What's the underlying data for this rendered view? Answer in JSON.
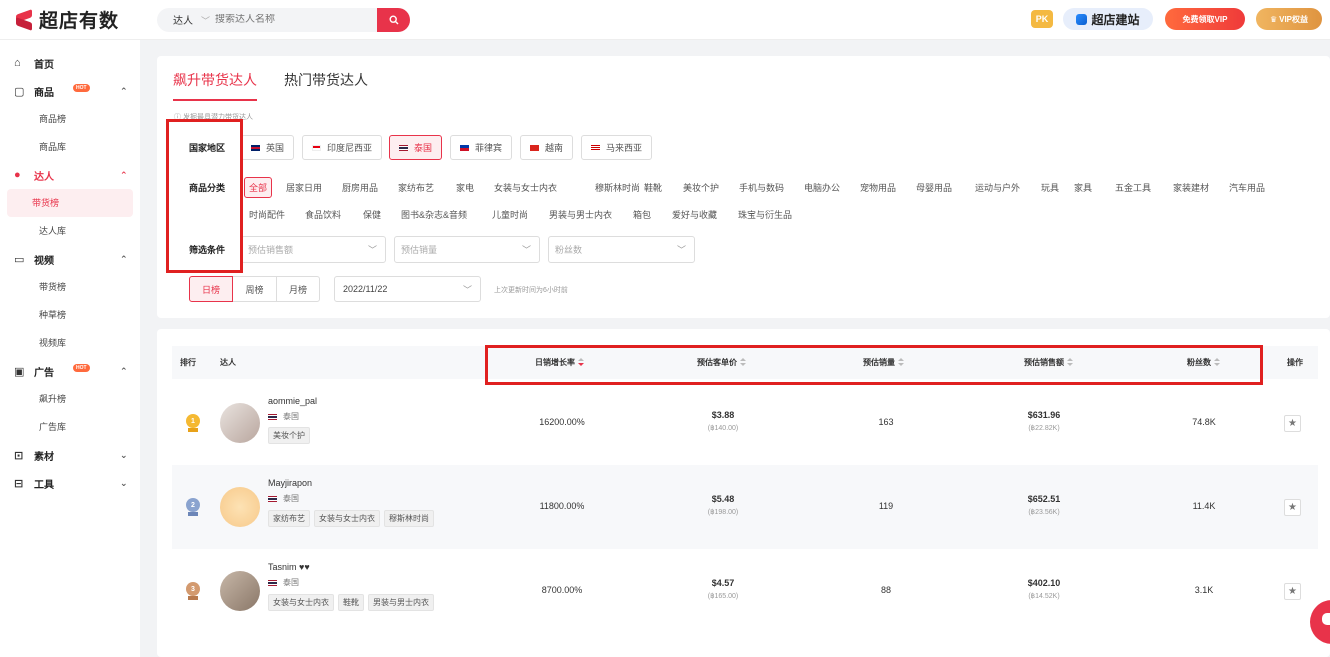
{
  "app": {
    "name": "超店有数"
  },
  "search": {
    "type": "达人",
    "placeholder": "搜索达人名称"
  },
  "topbar": {
    "pk": "PK",
    "build": "超店建站",
    "free_vip": "免费领取VIP",
    "vip": "VIP权益"
  },
  "sidebar": {
    "home": "首页",
    "products": {
      "label": "商品",
      "badge": "HOT",
      "items": [
        "商品榜",
        "商品库"
      ]
    },
    "creators": {
      "label": "达人",
      "items": [
        "带货榜",
        "达人库"
      ]
    },
    "video": {
      "label": "视频",
      "items": [
        "带货榜",
        "种草榜",
        "视频库"
      ]
    },
    "ads": {
      "label": "广告",
      "badge": "HOT",
      "items": [
        "飙升榜",
        "广告库"
      ]
    },
    "material": {
      "label": "素材"
    },
    "tools": {
      "label": "工具"
    }
  },
  "tabs": [
    "飙升带货达人",
    "热门带货达人"
  ],
  "tip": "发掘最具潜力带货达人",
  "filters": {
    "country_label": "国家地区",
    "category_label": "商品分类",
    "condition_label": "筛选条件",
    "countries": [
      "英国",
      "印度尼西亚",
      "泰国",
      "菲律宾",
      "越南",
      "马来西亚"
    ],
    "selected_country": "泰国",
    "categories_row1": [
      "全部",
      "居家日用",
      "厨房用品",
      "家纺布艺",
      "家电",
      "女装与女士内衣",
      "穆斯林时尚",
      "鞋靴",
      "美妆个护",
      "手机与数码",
      "电脑办公",
      "宠物用品",
      "母婴用品",
      "运动与户外",
      "玩具",
      "家具",
      "五金工具",
      "家装建材",
      "汽车用品"
    ],
    "categories_row2": [
      "时尚配件",
      "食品饮料",
      "保健",
      "图书&杂志&音频",
      "儿童时尚",
      "男装与男士内衣",
      "箱包",
      "爱好与收藏",
      "珠宝与衍生品"
    ],
    "conditions": [
      "预估销售额",
      "预估销量",
      "粉丝数"
    ],
    "periods": [
      "日榜",
      "周榜",
      "月榜"
    ],
    "date": "2022/11/22",
    "update_note": "上次更新时间为6小时前"
  },
  "table": {
    "headers": {
      "rank": "排行",
      "creator": "达人",
      "growth": "日销增长率",
      "unit_price": "预估客单价",
      "sales": "预估销量",
      "revenue": "预估销售额",
      "fans": "粉丝数",
      "action": "操作"
    },
    "rows": [
      {
        "rank": "1",
        "name": "aommie_pal",
        "country": "泰国",
        "tags": [
          "美妆个护"
        ],
        "growth": "16200.00%",
        "price": "$3.88",
        "price_local": "(฿140.00)",
        "sales": "163",
        "revenue": "$631.96",
        "revenue_local": "(฿22.82K)",
        "fans": "74.8K"
      },
      {
        "rank": "2",
        "name": "Mayjirapon",
        "country": "泰国",
        "tags": [
          "家纺布艺",
          "女装与女士内衣",
          "穆斯林时尚"
        ],
        "growth": "11800.00%",
        "price": "$5.48",
        "price_local": "(฿198.00)",
        "sales": "119",
        "revenue": "$652.51",
        "revenue_local": "(฿23.56K)",
        "fans": "11.4K"
      },
      {
        "rank": "3",
        "name": "Tasnim ♥♥",
        "country": "泰国",
        "tags": [
          "女装与女士内衣",
          "鞋靴",
          "男装与男士内衣"
        ],
        "growth": "8700.00%",
        "price": "$4.57",
        "price_local": "(฿165.00)",
        "sales": "88",
        "revenue": "$402.10",
        "revenue_local": "(฿14.52K)",
        "fans": "3.1K"
      }
    ]
  },
  "colors": {
    "accent": "#e8334a",
    "highlight_box": "#e02020"
  }
}
